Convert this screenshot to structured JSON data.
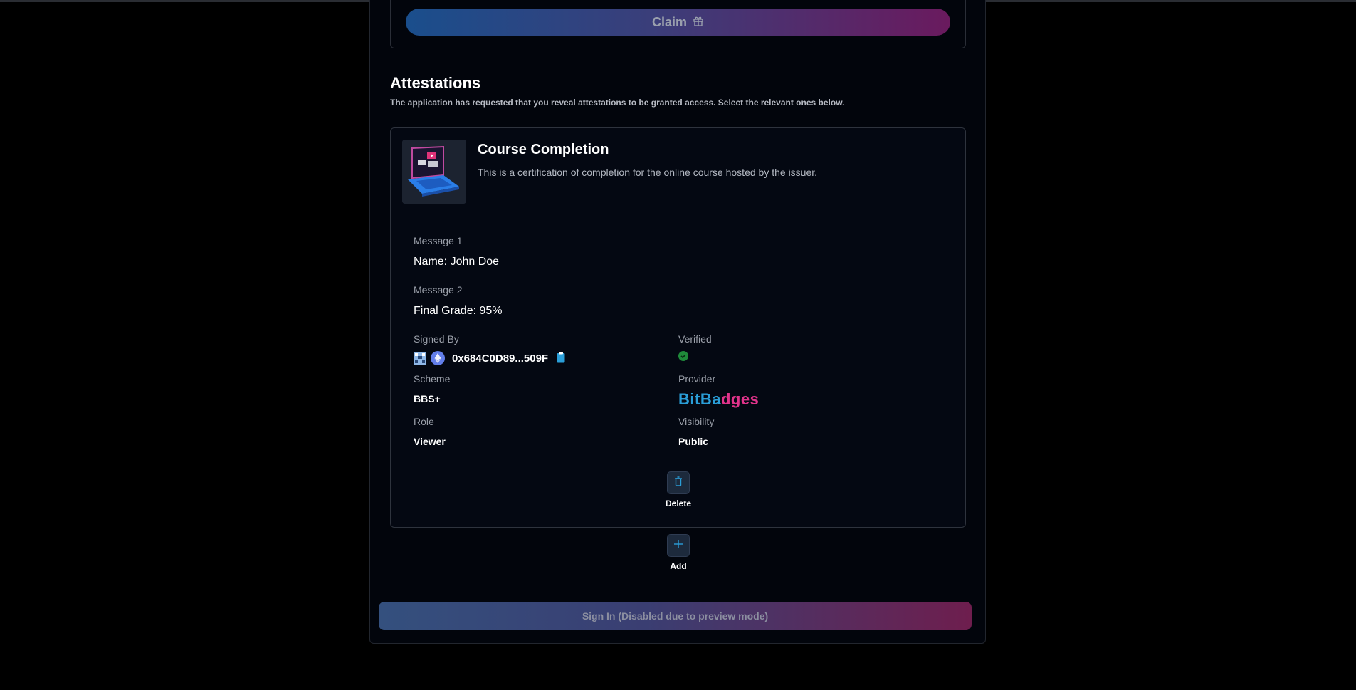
{
  "claim": {
    "label": "Claim",
    "icon": "gift-icon"
  },
  "attestations": {
    "title": "Attestations",
    "description": "The application has requested that you reveal attestations to be granted access. Select the relevant ones below."
  },
  "card": {
    "title": "Course Completion",
    "description": "This is a certification of completion for the online course hosted by the issuer.",
    "messages": [
      {
        "label": "Message 1",
        "value": "Name: John Doe"
      },
      {
        "label": "Message 2",
        "value": "Final Grade: 95%"
      }
    ],
    "signed_by": {
      "label": "Signed By",
      "address": "0x684C0D89...509F"
    },
    "verified": {
      "label": "Verified"
    },
    "scheme": {
      "label": "Scheme",
      "value": "BBS+"
    },
    "provider": {
      "label": "Provider",
      "logo_part1": "BitBa",
      "logo_part2": "dges"
    },
    "role": {
      "label": "Role",
      "value": "Viewer"
    },
    "visibility": {
      "label": "Visibility",
      "value": "Public"
    },
    "delete_label": "Delete"
  },
  "add_label": "Add",
  "signin_label": "Sign In (Disabled due to preview mode)",
  "colors": {
    "background": "#000000",
    "card_bg": "#040812",
    "accent_blue": "#2a9ed8",
    "accent_pink": "#e0338a",
    "verified_green": "#1f8a3a"
  }
}
